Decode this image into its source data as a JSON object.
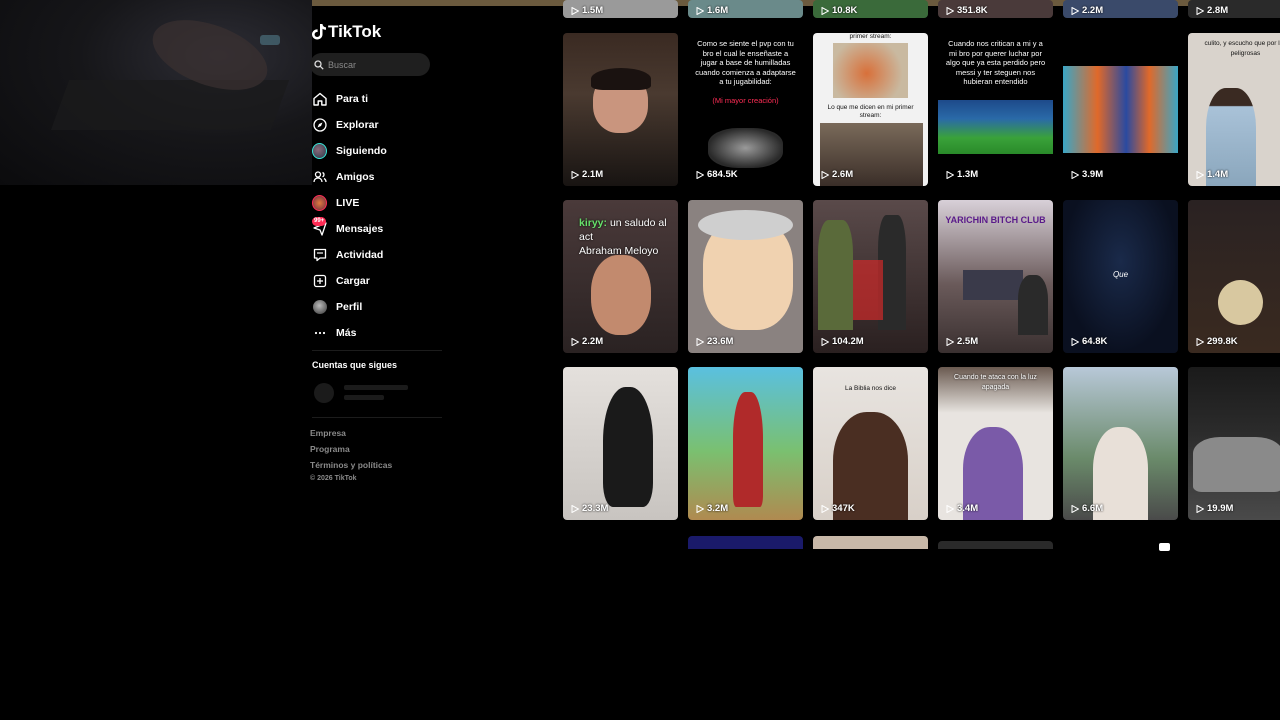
{
  "app": {
    "name": "TikTok"
  },
  "search": {
    "placeholder": "Buscar"
  },
  "nav": {
    "items": [
      {
        "label": "Para ti",
        "icon": "home-icon"
      },
      {
        "label": "Explorar",
        "icon": "compass-icon"
      },
      {
        "label": "Siguiendo",
        "icon": "following-avatar-icon"
      },
      {
        "label": "Amigos",
        "icon": "friends-icon"
      },
      {
        "label": "LIVE",
        "icon": "live-icon"
      },
      {
        "label": "Mensajes",
        "icon": "messages-icon",
        "badge": "99+"
      },
      {
        "label": "Actividad",
        "icon": "activity-icon"
      },
      {
        "label": "Cargar",
        "icon": "upload-icon"
      },
      {
        "label": "Perfil",
        "icon": "profile-avatar-icon"
      },
      {
        "label": "Más",
        "icon": "more-icon"
      }
    ]
  },
  "following_section": {
    "title": "Cuentas que sigues"
  },
  "footer": {
    "links": [
      "Empresa",
      "Programa",
      "Términos y políticas"
    ],
    "copyright": "© 2026 TikTok"
  },
  "grid": {
    "top_partial_views": [
      "1.5M",
      "1.6M",
      "10.8K",
      "351.8K",
      "2.2M",
      "2.8M"
    ],
    "tiles": [
      {
        "views": "2.1M",
        "caption": "",
        "caption_style": ""
      },
      {
        "views": "684.5K",
        "caption": "Como se siente el pvp con tu bro el cual le enseñaste a jugar a base de humilladas cuando comienza a adaptarse a tu jugabilidad:",
        "caption_red": "(Mi mayor creación)",
        "caption_style": "light"
      },
      {
        "views": "2.6M",
        "caption": "primer stream:",
        "caption2": "Lo que me dicen en mi primer stream:",
        "caption_style": "dark"
      },
      {
        "views": "1.3M",
        "caption": "Cuando nos critican a mi y a mi bro por querer luchar por algo que ya esta perdido pero messi y ter steguen nos hubieran entendido",
        "caption_style": "light"
      },
      {
        "views": "3.9M",
        "caption": "",
        "caption_style": ""
      },
      {
        "views": "1.4M",
        "caption": "culito, y escucho que por las peligrosas",
        "caption_style": "dark"
      },
      {
        "views": "2.2M",
        "chat_name": "kiryy:",
        "chat_text": "un saludo al act",
        "chat_line2": "Abraham Meloyo"
      },
      {
        "views": "23.6M",
        "caption": ""
      },
      {
        "views": "104.2M",
        "caption": ""
      },
      {
        "views": "2.5M",
        "caption": "YARICHIN BITCH CLUB"
      },
      {
        "views": "64.8K",
        "caption": "Que"
      },
      {
        "views": "299.8K",
        "caption": ""
      },
      {
        "views": "23.3M",
        "caption": ""
      },
      {
        "views": "3.2M",
        "caption": ""
      },
      {
        "views": "347K",
        "caption": "La Biblia nos dice"
      },
      {
        "views": "3.4M",
        "caption": "Cuando te ataca con la luz apagada"
      },
      {
        "views": "6.6M",
        "caption": ""
      },
      {
        "views": "19.9M",
        "caption": ""
      }
    ]
  },
  "colors": {
    "accent": "#fe2c55",
    "background": "#000000",
    "muted_text": "#8a8a8a"
  }
}
